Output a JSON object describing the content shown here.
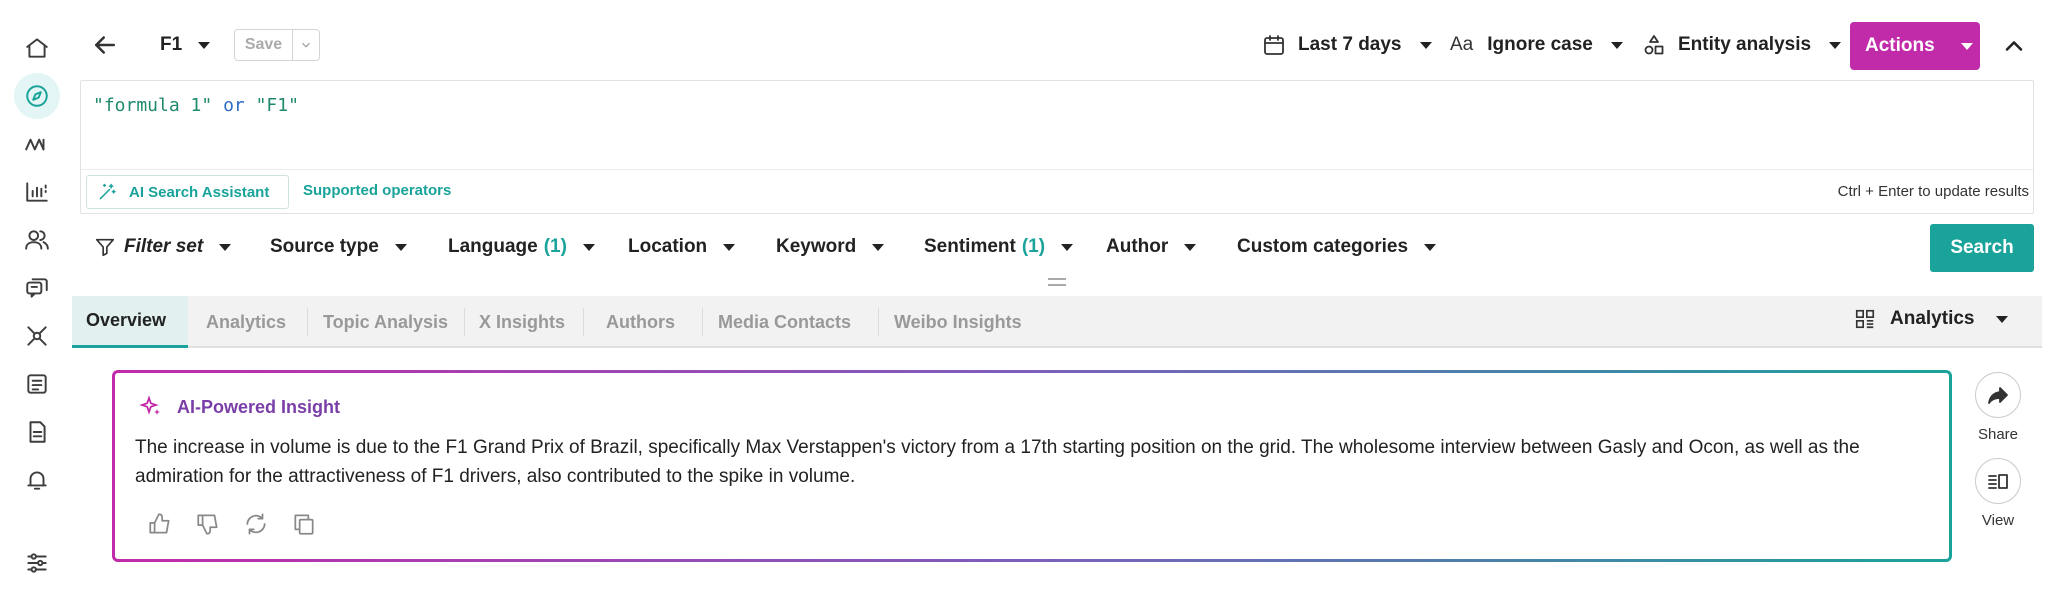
{
  "sidebar": {
    "items": [
      {
        "icon": "home-icon"
      },
      {
        "icon": "compass-icon",
        "active": true
      },
      {
        "icon": "trend-icon"
      },
      {
        "icon": "bar-chart-icon"
      },
      {
        "icon": "users-icon"
      },
      {
        "icon": "chat-icon"
      },
      {
        "icon": "network-icon"
      },
      {
        "icon": "newspaper-icon"
      },
      {
        "icon": "report-icon"
      },
      {
        "icon": "bell-icon"
      },
      {
        "icon": "sliders-icon"
      }
    ]
  },
  "toolbar": {
    "query_name": "F1",
    "save_label": "Save",
    "date_range": "Last 7 days",
    "case_icon_text": "Aa",
    "case_mode": "Ignore case",
    "analysis_mode": "Entity analysis",
    "actions_label": "Actions"
  },
  "query": {
    "term1": "\"formula 1\"",
    "operator": "or",
    "term2": "\"F1\"",
    "ai_assistant_label": "AI Search Assistant",
    "operators_link": "Supported operators",
    "hint": "Ctrl + Enter to update results"
  },
  "filters": {
    "filter_set": "Filter set",
    "source_type": "Source type",
    "language": "Language",
    "language_count": "(1)",
    "location": "Location",
    "keyword": "Keyword",
    "sentiment": "Sentiment",
    "sentiment_count": "(1)",
    "author": "Author",
    "custom_categories": "Custom categories",
    "search_label": "Search"
  },
  "tabs": {
    "items": [
      "Overview",
      "Analytics",
      "Topic Analysis",
      "X Insights",
      "Authors",
      "Media Contacts",
      "Weibo Insights"
    ],
    "active": "Overview",
    "view_selector": "Analytics"
  },
  "insight": {
    "title": "AI-Powered Insight",
    "text": "The increase in volume is due to the F1 Grand Prix of Brazil, specifically Max Verstappen's victory from a 17th starting position on the grid. The wholesome interview between Gasly and Ocon, as well as the admiration for the attractiveness of F1 drivers, also contributed to the spike in volume."
  },
  "side_actions": {
    "share_label": "Share",
    "view_label": "View"
  },
  "colors": {
    "accent_teal": "#1aa39a",
    "accent_magenta": "#c12aa9"
  }
}
